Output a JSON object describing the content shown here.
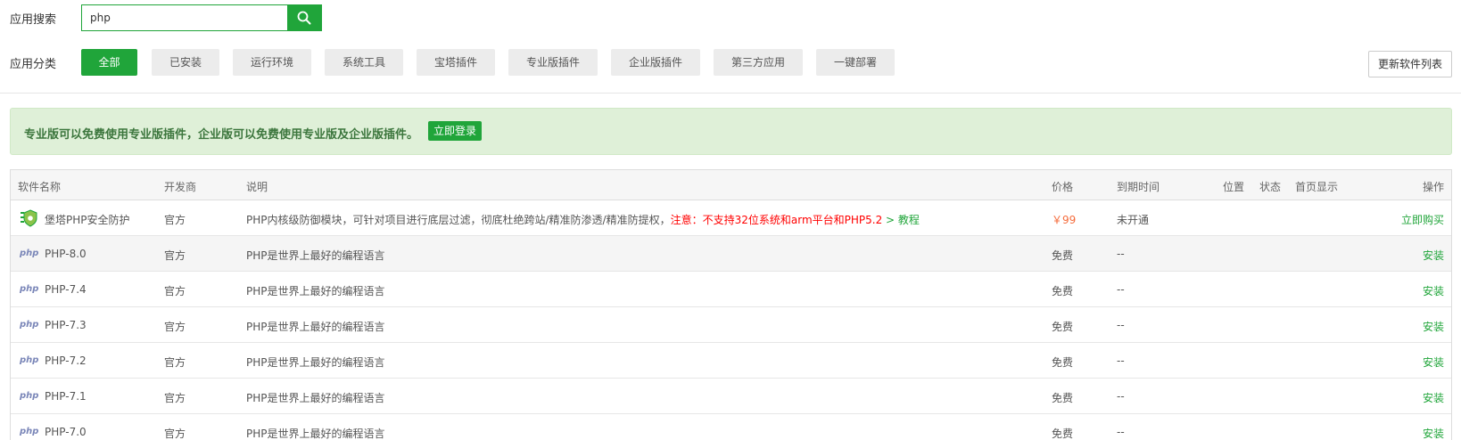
{
  "search": {
    "label": "应用搜索",
    "value": "php"
  },
  "categories": {
    "label": "应用分类",
    "items": [
      "全部",
      "已安装",
      "运行环境",
      "系统工具",
      "宝塔插件",
      "专业版插件",
      "企业版插件",
      "第三方应用",
      "一键部署"
    ],
    "active": "全部"
  },
  "update_button": "更新软件列表",
  "alert": {
    "text": "专业版可以免费使用专业版插件，企业版可以免费使用专业版及企业版插件。",
    "login": "立即登录"
  },
  "table": {
    "headers": {
      "name": "软件名称",
      "dev": "开发商",
      "desc": "说明",
      "price": "价格",
      "expire": "到期时间",
      "position": "位置",
      "status": "状态",
      "homepage": "首页显示",
      "ops": "操作"
    },
    "rows": [
      {
        "icon": "bt-shield-icon",
        "name": "堡塔PHP安全防护",
        "dev": "官方",
        "desc": "PHP内核级防御模块，可针对项目进行底层过滤，彻底杜绝跨站/精准防渗透/精准防提权，",
        "desc_warn": "注意：不支持32位系统和arm平台和PHP5.2",
        "desc_link": " > 教程",
        "price": "￥99",
        "expire": "未开通",
        "op": "立即购买"
      },
      {
        "icon": "php-icon",
        "logo": "php",
        "name": "PHP-8.0",
        "dev": "官方",
        "desc": "PHP是世界上最好的编程语言",
        "price": "免费",
        "expire": "--",
        "op": "安装"
      },
      {
        "icon": "php-icon",
        "logo": "php",
        "name": "PHP-7.4",
        "dev": "官方",
        "desc": "PHP是世界上最好的编程语言",
        "price": "免费",
        "expire": "--",
        "op": "安装"
      },
      {
        "icon": "php-icon",
        "logo": "php",
        "name": "PHP-7.3",
        "dev": "官方",
        "desc": "PHP是世界上最好的编程语言",
        "price": "免费",
        "expire": "--",
        "op": "安装"
      },
      {
        "icon": "php-icon",
        "logo": "php",
        "name": "PHP-7.2",
        "dev": "官方",
        "desc": "PHP是世界上最好的编程语言",
        "price": "免费",
        "expire": "--",
        "op": "安装"
      },
      {
        "icon": "php-icon",
        "logo": "php",
        "name": "PHP-7.1",
        "dev": "官方",
        "desc": "PHP是世界上最好的编程语言",
        "price": "免费",
        "expire": "--",
        "op": "安装"
      },
      {
        "icon": "php-icon",
        "logo": "php",
        "name": "PHP-7.0",
        "dev": "官方",
        "desc": "PHP是世界上最好的编程语言",
        "price": "免费",
        "expire": "--",
        "op": "安装"
      }
    ]
  },
  "colors": {
    "accent": "#20a53a",
    "warning": "#ff0000",
    "price": "#f56c3c",
    "alert_bg": "#dff0d8"
  }
}
